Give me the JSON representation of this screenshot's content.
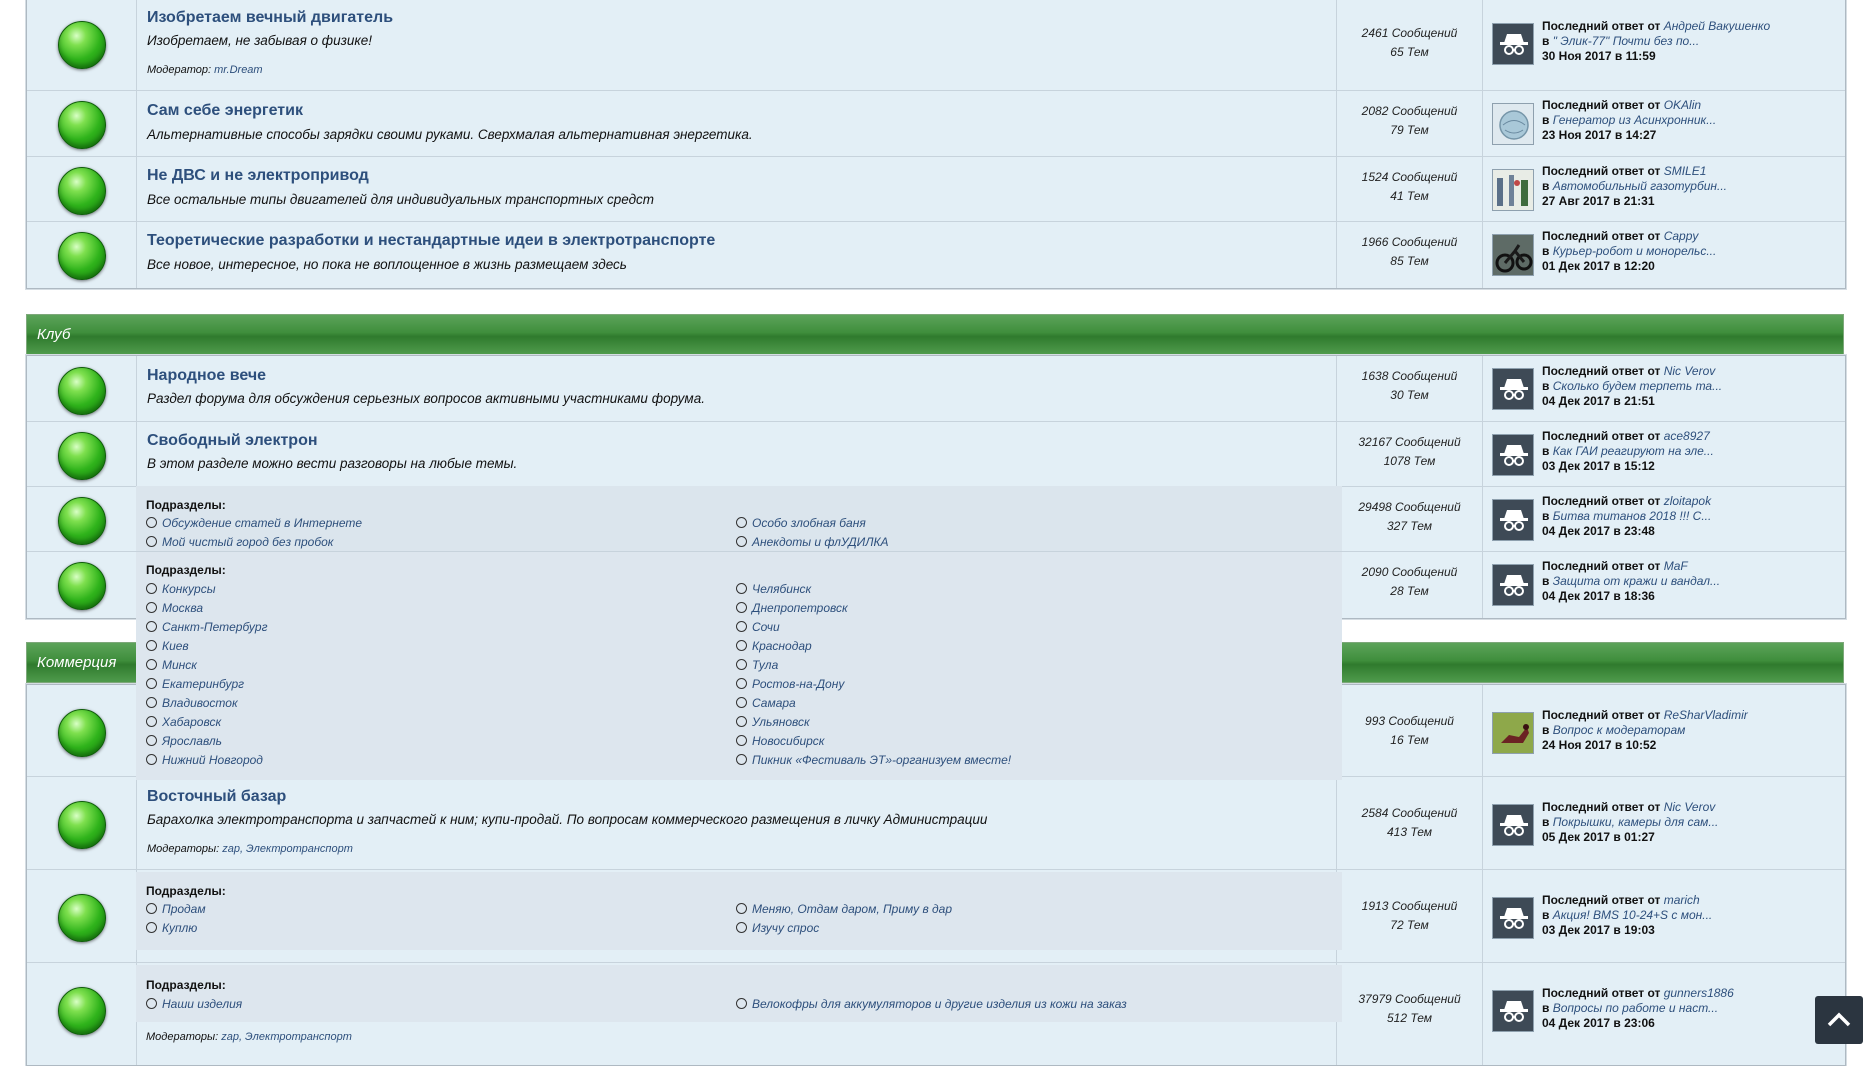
{
  "forums_top": [
    {
      "title": "Изобретаем вечный двигатель",
      "desc": "Изобретаем, не забывая о физике!",
      "mod_label": "Модератор:",
      "mods": "mr.Dream",
      "posts": "2461 Сообщений",
      "topics": "65 Тем",
      "last_label": "Последний ответ",
      "from": "от",
      "by": "Андрей Вакушенко",
      "in": "в",
      "topic": "\" Элик-77\" Почти без по...",
      "date": "30 Ноя 2017 в 11:59",
      "avatar": "spy"
    },
    {
      "title": "Сам себе энергетик",
      "desc": "Альтернативные способы зарядки своими руками. Сверхмалая альтернативная энергетика.",
      "posts": "2082 Сообщений",
      "topics": "79 Тем",
      "last_label": "Последний ответ",
      "from": "от",
      "by": "OKAlin",
      "in": "в",
      "topic": "Генератор из Асинхронник...",
      "date": "23 Ноя 2017 в 14:27",
      "avatar": "globe"
    },
    {
      "title": "Не ДВС и не электропривод",
      "desc": "Все остальные типы двигателей для индивидуальных транспортных средст",
      "posts": "1524 Сообщений",
      "topics": "41 Тем",
      "last_label": "Последний ответ",
      "from": "от",
      "by": "SMILE1",
      "in": "в",
      "topic": "Автомобильный газотурбин...",
      "date": "27 Авг 2017 в 21:31",
      "avatar": "photo"
    },
    {
      "title": "Теоретические разработки и нестандартные идеи в электротранспорте",
      "desc": "Все новое, интересное, но пока не воплощенное в жизнь размещаем здесь",
      "posts": "1966 Сообщений",
      "topics": "85 Тем",
      "last_label": "Последний ответ",
      "from": "от",
      "by": "Cappy",
      "in": "в",
      "topic": "Курьер-робот и монорельс...",
      "date": "01 Дек 2017 в 12:20",
      "avatar": "bike"
    }
  ],
  "club": {
    "header": "Клуб",
    "forums": [
      {
        "title": "Народное вече",
        "desc": "Раздел форума для обсуждения серьезных вопросов активными участниками форума.",
        "posts": "1638 Сообщений",
        "topics": "30 Тем",
        "last_label": "Последний ответ",
        "from": "от",
        "by": "Nic Verov",
        "in": "в",
        "topic": "Сколько будем терпеть та...",
        "date": "04 Дек 2017 в 21:51"
      },
      {
        "title": "Свободный электрон",
        "desc": "В этом разделе можно вести разговоры на любые темы.",
        "posts": "32167 Сообщений",
        "topics": "1078 Тем",
        "last_label": "Последний ответ",
        "from": "от",
        "by": "ace8927",
        "in": "в",
        "topic": "Как ГАИ реагируют на эле...",
        "date": "03 Дек 2017 в 15:12"
      },
      {
        "posts": "29498 Сообщений",
        "topics": "327 Тем",
        "last_label": "Последний ответ",
        "from": "от",
        "by": "zloitapok",
        "in": "в",
        "topic": "Битва титанов 2018 !!! С...",
        "date": "04 Дек 2017 в 23:48"
      },
      {
        "posts": "2090 Сообщений",
        "topics": "28 Тем",
        "last_label": "Последний ответ",
        "from": "от",
        "by": "MaF",
        "in": "в",
        "topic": "Защита от кражи и вандал...",
        "date": "04 Дек 2017 в 18:36"
      }
    ],
    "sub1": {
      "label": "Подразделы:",
      "left": [
        "Обсуждение статей в Интернете",
        "Мой чистый город без пробок"
      ],
      "right": [
        "Особо злобная баня",
        "Анекдоты и флУДИЛКА"
      ]
    },
    "sub2": {
      "label": "Подразделы:",
      "left": [
        "Конкурсы",
        "Москва",
        "Санкт-Петербург",
        "Киев",
        "Минск",
        "Екатеринбург",
        "Владивосток",
        "Хабаровск",
        "Ярославль",
        "Нижний Новгород"
      ],
      "right": [
        "Челябинск",
        "Днепропетровск",
        "Сочи",
        "Краснодар",
        "Тула",
        "Ростов-на-Дону",
        "Самара",
        "Ульяновск",
        "Новосибирск",
        "Пикник «Фестиваль ЭТ»-организуем вместе!"
      ]
    }
  },
  "commerce": {
    "header": "Коммерция",
    "forums": [
      {
        "posts": "993 Сообщений",
        "topics": "16 Тем",
        "last_label": "Последний ответ",
        "from": "от",
        "by": "ReSharVladimir",
        "in": "в",
        "topic": "Вопрос к модераторам",
        "date": "24 Ноя 2017 в 10:52"
      },
      {
        "title": "Восточный базар",
        "desc": "Барахолка электротранспорта и запчастей к ним; купи-продай. По вопросам коммерческого размещения в личку Администрации",
        "mod_label": "Модераторы:",
        "mods": "zap, Электротранспорт",
        "posts": "2584 Сообщений",
        "topics": "413 Тем",
        "last_label": "Последний ответ",
        "from": "от",
        "by": "Nic Verov",
        "in": "в",
        "topic": "Покрышки, камеры для сам...",
        "date": "05 Дек 2017 в 01:27"
      },
      {
        "posts": "1913 Сообщений",
        "topics": "72 Тем",
        "last_label": "Последний ответ",
        "from": "от",
        "by": "marich",
        "in": "в",
        "topic": "Акция! BMS 10-24+S с мон...",
        "date": "03 Дек 2017 в 19:03"
      },
      {
        "mod_label": "Модераторы:",
        "mods": "zap, Электротранспорт",
        "posts": "37979 Сообщений",
        "topics": "512 Тем",
        "last_label": "Последний ответ",
        "from": "от",
        "by": "gunners1886",
        "in": "в",
        "topic": "Вопросы по работе и наст...",
        "date": "04 Дек 2017 в 23:06"
      }
    ],
    "sub3": {
      "label": "Подразделы:",
      "left": [
        "Продам",
        "Куплю"
      ],
      "right": [
        "Меняю, Отдам даром, Приму в дар",
        "Изучу спрос"
      ]
    },
    "sub4": {
      "label": "Подразделы:",
      "left": [
        "Наши изделия"
      ],
      "right": [
        "Велокофры для аккумуляторов и другие изделия из кожи на заказ"
      ]
    }
  },
  "back_to_top_icon": "chevron-up-icon"
}
